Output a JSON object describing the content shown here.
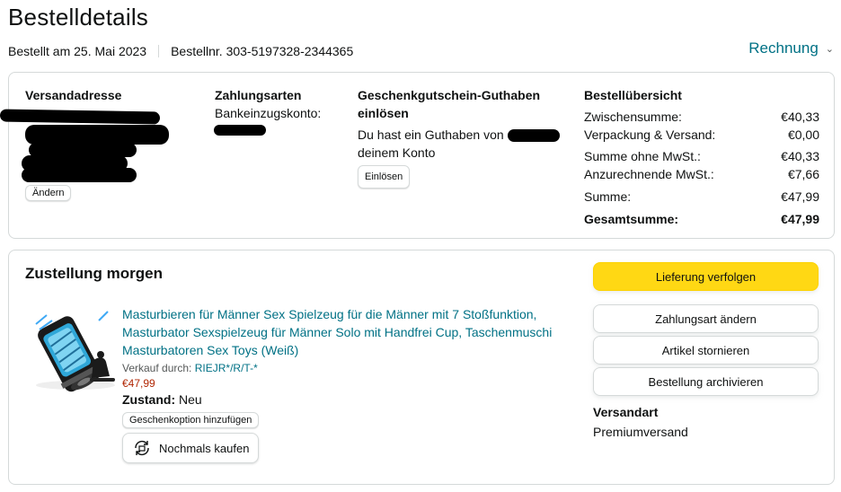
{
  "page": {
    "title": "Bestelldetails",
    "ordered_on": "Bestellt am 25. Mai 2023",
    "order_number": "Bestellnr. 303-5197328-2344365",
    "invoice_label": "Rechnung"
  },
  "details": {
    "address": {
      "heading": "Versandadresse",
      "change_label": "Ändern"
    },
    "payment": {
      "heading": "Zahlungsarten",
      "method": "Bankeinzugskonto:"
    },
    "gift": {
      "heading": "Geschenkgutschein-Guthaben einlösen",
      "text_before": "Du hast ein Guthaben von",
      "text_after": "deinem Konto",
      "redeem_label": "Einlösen"
    },
    "summary": {
      "heading": "Bestellübersicht",
      "rows": [
        {
          "label": "Zwischensumme:",
          "value": "€40,33"
        },
        {
          "label": "Verpackung & Versand:",
          "value": "€0,00"
        },
        {
          "label": "Summe ohne MwSt.:",
          "value": "€40,33"
        },
        {
          "label": "Anzurechnende MwSt.:",
          "value": "€7,66"
        },
        {
          "label": "Summe:",
          "value": "€47,99"
        }
      ],
      "total_label": "Gesamtsumme:",
      "total_value": "€47,99"
    }
  },
  "shipment": {
    "status": "Zustellung morgen",
    "product": {
      "title": "Masturbieren für Männer Sex Spielzeug für die Männer mit 7 Stoßfunktion, Masturbator Sexspielzeug für Männer Solo mit Handfrei Cup, Taschenmuschi Masturbatoren Sex Toys (Weiß)",
      "seller_prefix": "Verkauf durch:",
      "seller_name": "RIEJR*/R/T-*",
      "price": "€47,99",
      "condition_label": "Zustand:",
      "condition_value": "Neu",
      "gift_option_label": "Geschenkoption hinzufügen",
      "buy_again_label": "Nochmals kaufen"
    },
    "actions": {
      "track": "Lieferung verfolgen",
      "change_payment": "Zahlungsart ändern",
      "cancel": "Artikel stornieren",
      "archive": "Bestellung archivieren"
    },
    "shipping_method_heading": "Versandart",
    "shipping_method_value": "Premiumversand"
  },
  "colors": {
    "link": "#007185",
    "price": "#b12704",
    "primary_button": "#ffd814",
    "border": "#d5d9d9"
  }
}
